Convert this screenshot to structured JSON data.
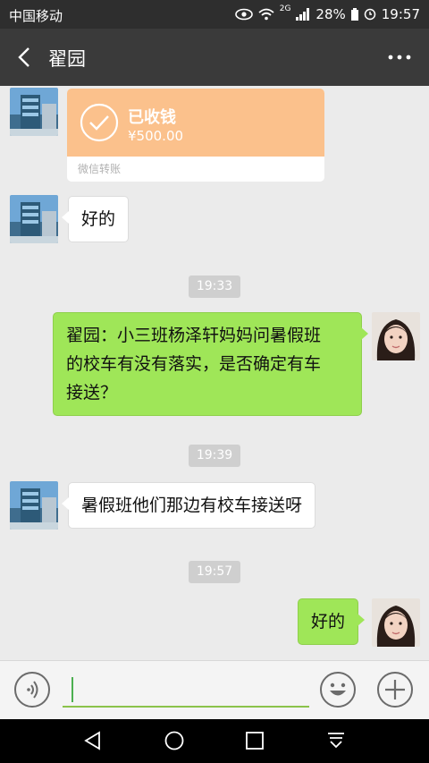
{
  "status_bar": {
    "carrier": "中国移动",
    "network": "2G",
    "battery": "28%",
    "time": "19:57"
  },
  "nav": {
    "title": "翟园"
  },
  "messages": [
    {
      "kind": "transfer",
      "side": "left",
      "status": "已收钱",
      "amount": "¥500.00",
      "footer": "微信转账"
    },
    {
      "kind": "text",
      "side": "left",
      "text": "好的"
    },
    {
      "kind": "time",
      "text": "19:33"
    },
    {
      "kind": "text",
      "side": "right",
      "lines": [
        "翟园：小三班杨泽轩妈妈问暑假班",
        "的校车有没有落实，是否确定有车",
        "接送？"
      ]
    },
    {
      "kind": "time",
      "text": "19:39"
    },
    {
      "kind": "text",
      "side": "left",
      "text": "暑假班他们那边有校车接送呀"
    },
    {
      "kind": "time",
      "text": "19:57"
    },
    {
      "kind": "text",
      "side": "right",
      "text": "好的"
    }
  ],
  "colors": {
    "outgoing_bubble": "#9fe658",
    "transfer_card": "#fbc18c",
    "navbar": "#3a3a3a"
  },
  "icons": [
    "back-arrow-icon",
    "more-dots-icon",
    "voice-icon",
    "emoji-icon",
    "plus-icon",
    "nav-back-icon",
    "nav-home-icon",
    "nav-recent-icon",
    "nav-hide-keyboard-icon"
  ]
}
